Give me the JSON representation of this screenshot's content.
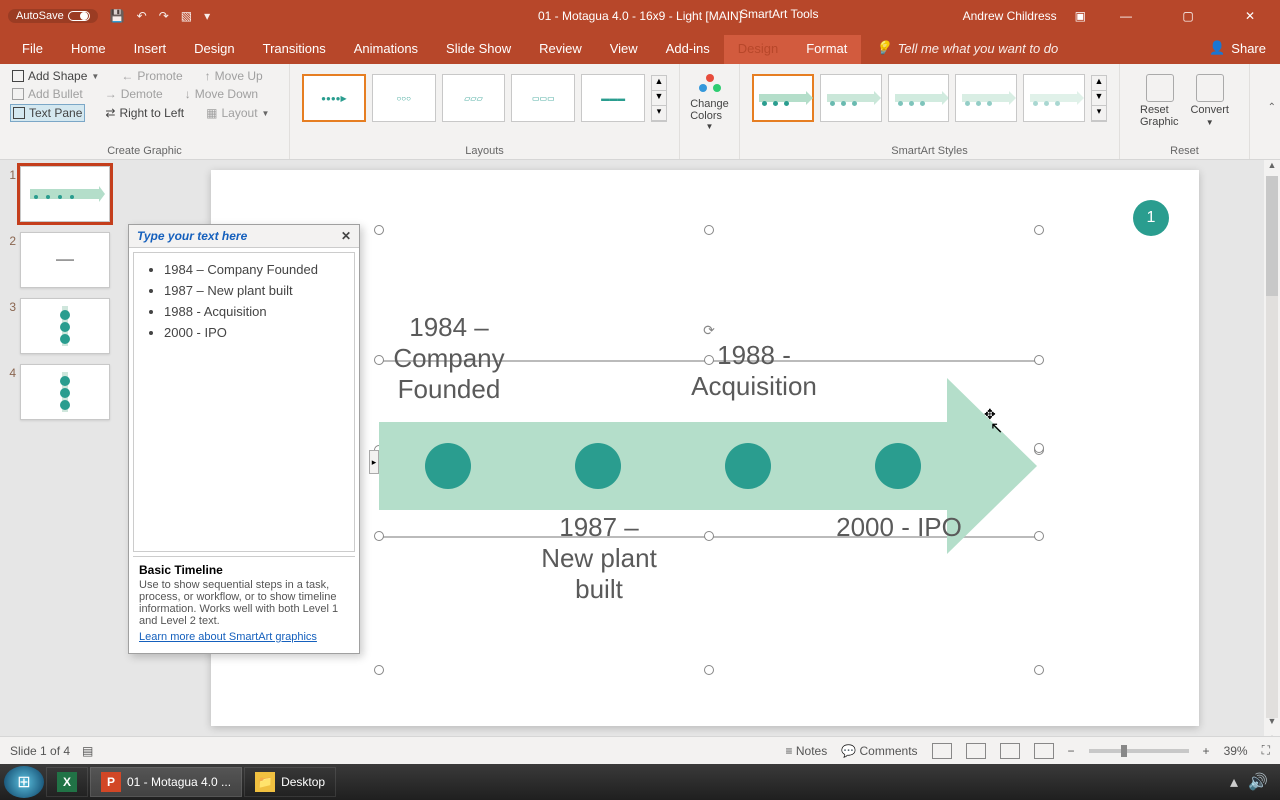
{
  "titlebar": {
    "autosave": "AutoSave",
    "doc_title": "01 - Motagua 4.0 - 16x9 - Light [MAIN]",
    "tools_title": "SmartArt Tools",
    "user": "Andrew Childress"
  },
  "tabs": {
    "file": "File",
    "home": "Home",
    "insert": "Insert",
    "design": "Design",
    "transitions": "Transitions",
    "animations": "Animations",
    "slideshow": "Slide Show",
    "review": "Review",
    "view": "View",
    "addins": "Add-ins",
    "sa_design": "Design",
    "sa_format": "Format",
    "tellme": "Tell me what you want to do",
    "share": "Share"
  },
  "ribbon": {
    "create_graphic": "Create Graphic",
    "add_shape": "Add Shape",
    "add_bullet": "Add Bullet",
    "text_pane": "Text Pane",
    "promote": "Promote",
    "demote": "Demote",
    "rtl": "Right to Left",
    "move_up": "Move Up",
    "move_down": "Move Down",
    "layout": "Layout",
    "layouts": "Layouts",
    "change_colors": "Change Colors",
    "smartart_styles": "SmartArt Styles",
    "reset_graphic": "Reset Graphic",
    "convert": "Convert",
    "reset": "Reset"
  },
  "thumbs": {
    "n1": "1",
    "n2": "2",
    "n3": "3",
    "n4": "4"
  },
  "textpane": {
    "title": "Type your text here",
    "items": [
      "1984  – Company Founded",
      "1987 – New plant built",
      "1988  - Acquisition",
      "2000  - IPO"
    ],
    "footer_title": "Basic Timeline",
    "footer_desc": "Use to show sequential steps in a task, process, or workflow, or to show timeline information. Works well with both Level 1 and Level 2 text.",
    "footer_link": "Learn more about SmartArt graphics"
  },
  "slide": {
    "badge": "1",
    "lab1a": "1984 –",
    "lab1b": "Company",
    "lab1c": "Founded",
    "lab2a": "1987 –",
    "lab2b": "New plant",
    "lab2c": "built",
    "lab3a": "1988 -",
    "lab3b": "Acquisition",
    "lab4": "2000 - IPO"
  },
  "status": {
    "slide_of": "Slide 1 of 4",
    "notes": "Notes",
    "comments": "Comments",
    "zoom": "39%"
  },
  "taskbar": {
    "ppt": "01 - Motagua 4.0 ...",
    "desktop": "Desktop"
  }
}
